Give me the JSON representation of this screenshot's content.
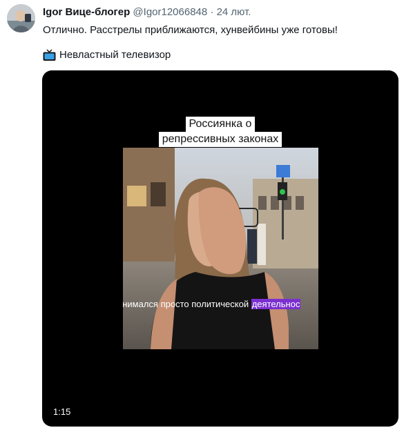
{
  "tweet": {
    "author_name": "Igor Вице-блогер",
    "handle": "@Igor12066848",
    "separator": "·",
    "date": "24 лют.",
    "text": "Отлично. Расстрелы приближаются, хунвейбины уже готовы!",
    "source_icon": "tv-icon",
    "source_label": "Невластный телевизор"
  },
  "video": {
    "caption_line1": "Россиянка о",
    "caption_line2": "репрессивных законах",
    "subtitle_before": "анимался просто политической ",
    "subtitle_highlight": "деятельнос",
    "duration": "1:15"
  },
  "colors": {
    "text": "#0f1419",
    "muted": "#536471",
    "media_bg": "#000000",
    "subtitle_highlight": "#7b2fd0"
  }
}
